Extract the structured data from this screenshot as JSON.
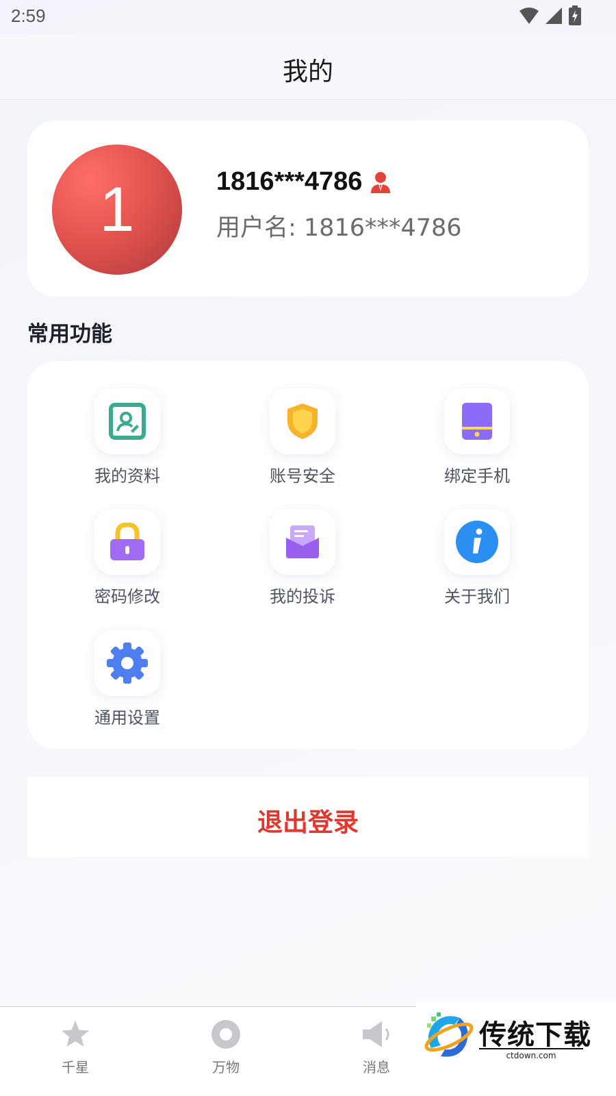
{
  "status_bar": {
    "time": "2:59",
    "icons": [
      "wifi-icon",
      "signal-icon",
      "battery-charging-icon"
    ]
  },
  "header": {
    "title": "我的"
  },
  "profile": {
    "avatar_text": "1",
    "avatar_color": "#e35450",
    "name": "1816***4786",
    "badge_icon": "user-suit-icon",
    "username": "用户名: 1816***4786"
  },
  "functions": {
    "title": "常用功能",
    "items": [
      {
        "label": "我的资料",
        "icon": "profile-card-icon",
        "color": "#3aab8f"
      },
      {
        "label": "账号安全",
        "icon": "shield-icon",
        "color": "#f7b32b"
      },
      {
        "label": "绑定手机",
        "icon": "phone-icon",
        "color": "#8a6cf7"
      },
      {
        "label": "密码修改",
        "icon": "lock-icon",
        "color": "#a26cf2"
      },
      {
        "label": "我的投诉",
        "icon": "complaint-box-icon",
        "color": "#9b5ff0"
      },
      {
        "label": "关于我们",
        "icon": "info-icon",
        "color": "#2a8ff0"
      },
      {
        "label": "通用设置",
        "icon": "gear-icon",
        "color": "#4e7ef0"
      }
    ]
  },
  "logout": {
    "label": "退出登录",
    "color": "#e0372f"
  },
  "tabbar": {
    "tabs": [
      {
        "label": "千星",
        "icon": "star-icon"
      },
      {
        "label": "万物",
        "icon": "circle-icon"
      },
      {
        "label": "消息",
        "icon": "speaker-icon"
      }
    ]
  },
  "watermark": {
    "title": "传统下载",
    "url": "ctdown.com"
  }
}
